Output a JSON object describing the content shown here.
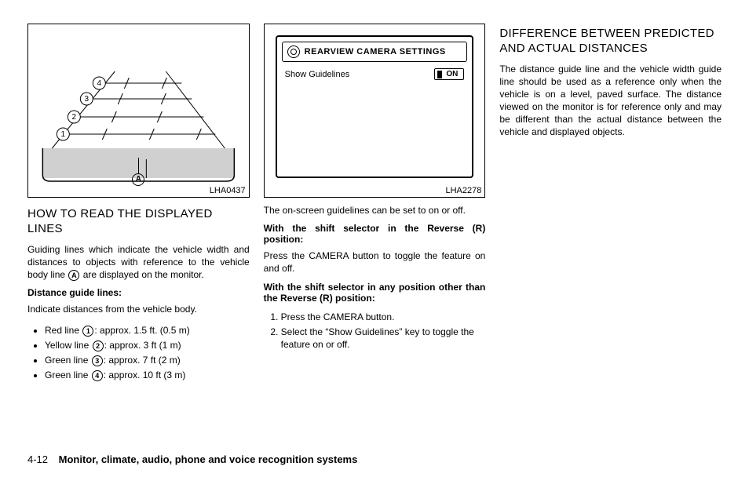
{
  "col1": {
    "fig_label": "LHA0437",
    "h": "HOW TO READ THE DISPLAYED LINES",
    "p1a": "Guiding lines which indicate the vehicle width and distances to objects with reference to the vehicle body line ",
    "p1_ref": "A",
    "p1b": " are displayed on the monitor.",
    "sub": "Distance guide lines:",
    "p2": "Indicate distances from the vehicle body.",
    "b1a": "Red line ",
    "b1r": "1",
    "b1b": ": approx. 1.5 ft. (0.5 m)",
    "b2a": "Yellow line ",
    "b2r": "2",
    "b2b": ": approx. 3 ft (1 m)",
    "b3a": "Green line ",
    "b3r": "3",
    "b3b": ": approx. 7 ft (2 m)",
    "b4a": "Green line ",
    "b4r": "4",
    "b4b": ": approx. 10 ft (3 m)"
  },
  "col2": {
    "fig_label": "LHA2278",
    "fig_title": "REARVIEW CAMERA SETTINGS",
    "fig_row_label": "Show Guidelines",
    "fig_toggle": "ON",
    "p1": "The on-screen guidelines can be set to on or off.",
    "sub1": "With the shift selector in the Reverse (R) position:",
    "p2": "Press the CAMERA button to toggle the feature on and off.",
    "sub2": "With the shift selector in any position other than the Reverse (R) position:",
    "o1": "Press the CAMERA button.",
    "o2": "Select the “Show Guidelines” key to toggle the feature on or off."
  },
  "col3": {
    "h": "DIFFERENCE BETWEEN PREDICTED AND ACTUAL DISTANCES",
    "p1": "The distance guide line and the vehicle width guide line should be used as a reference only when the vehicle is on a level, paved surface. The distance viewed on the monitor is for reference only and may be different than the actual distance between the vehicle and displayed objects."
  },
  "footer": {
    "page": "4-12",
    "chapter": "Monitor, climate, audio, phone and voice recognition systems"
  }
}
